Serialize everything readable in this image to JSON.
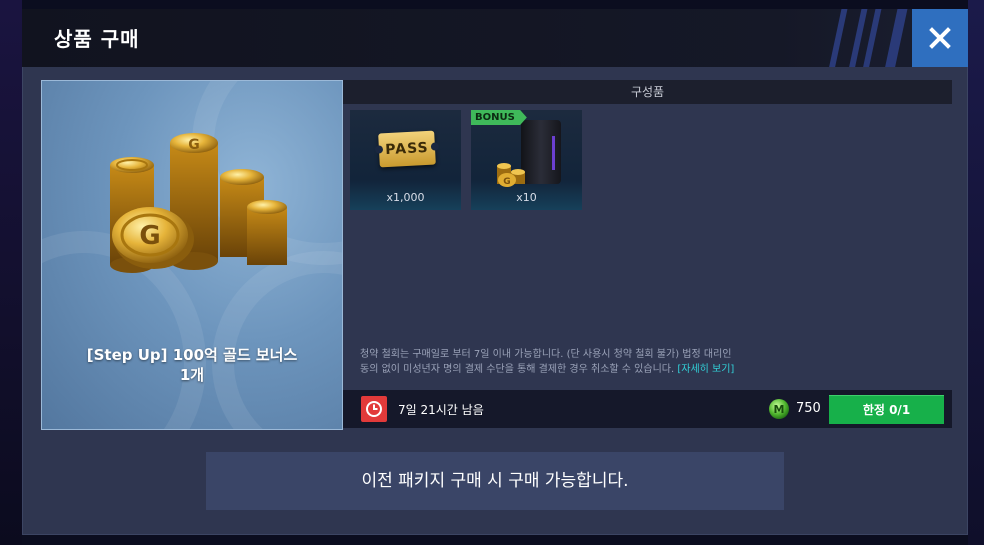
{
  "header": {
    "title": "상품 구매",
    "close_icon": "close-icon"
  },
  "product": {
    "name_line1": "[Step Up] 100억 골드 보너스",
    "name_line2": "1개",
    "image_icon": "gold-coins-pile-icon"
  },
  "contents": {
    "header_label": "구성품",
    "items": [
      {
        "icon": "pass-ticket-icon",
        "ticket_text": "PASS",
        "quantity": "x1,000",
        "badge": null
      },
      {
        "icon": "bonus-bag-coins-icon",
        "quantity": "x10",
        "badge": "BONUS"
      }
    ]
  },
  "notice": {
    "line1": "청약 철회는 구매일로 부터 7일 이내 가능합니다. (단 사용시 청약 철회 불가) 법정 대리인",
    "line2": "동의 없이 미성년자 명의 결제 수단을 통해 결제한 경우 취소할 수 있습니다.",
    "link_label": "[자세히 보기]"
  },
  "purchase_bar": {
    "timer_icon": "clock-icon",
    "time_remaining": "7일 21시간 남음",
    "currency_icon": "m-coin-icon",
    "price": "750",
    "buy_button_label": "한정 0/1"
  },
  "message": {
    "text": "이전 패키지 구매 시 구매 가능합니다."
  },
  "colors": {
    "accent_blue": "#2f6fbf",
    "buy_green": "#17b04a",
    "timer_red": "#e23a3a",
    "link_cyan": "#32d0d8"
  }
}
